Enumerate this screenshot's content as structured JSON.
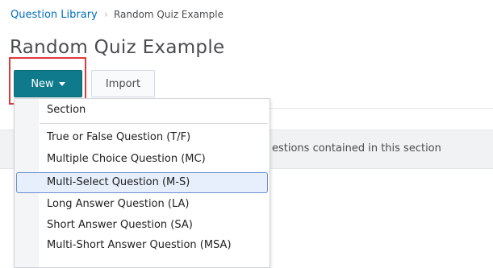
{
  "breadcrumb": {
    "parent": "Question Library",
    "separator": "›",
    "current": "Random Quiz Example"
  },
  "page_title": "Random Quiz Example",
  "toolbar": {
    "new_label": "New",
    "import_label": "Import"
  },
  "section_info": {
    "text": "estions contained in this section"
  },
  "new_menu": {
    "items": [
      {
        "label": "Section"
      },
      {
        "label": "True or False Question (T/F)"
      },
      {
        "label": "Multiple Choice Question (MC)"
      },
      {
        "label": "Multi-Select Question (M-S)",
        "selected": true
      },
      {
        "label": "Long Answer Question (LA)"
      },
      {
        "label": "Short Answer Question (SA)"
      },
      {
        "label": "Multi-Short Answer Question (MSA)"
      }
    ]
  },
  "colors": {
    "link": "#006fbf",
    "primary_button": "#0e7a8c",
    "highlight_outline": "#e0383e",
    "selected_item_bg": "#e6effb",
    "selected_item_border": "#6a8fd2"
  }
}
